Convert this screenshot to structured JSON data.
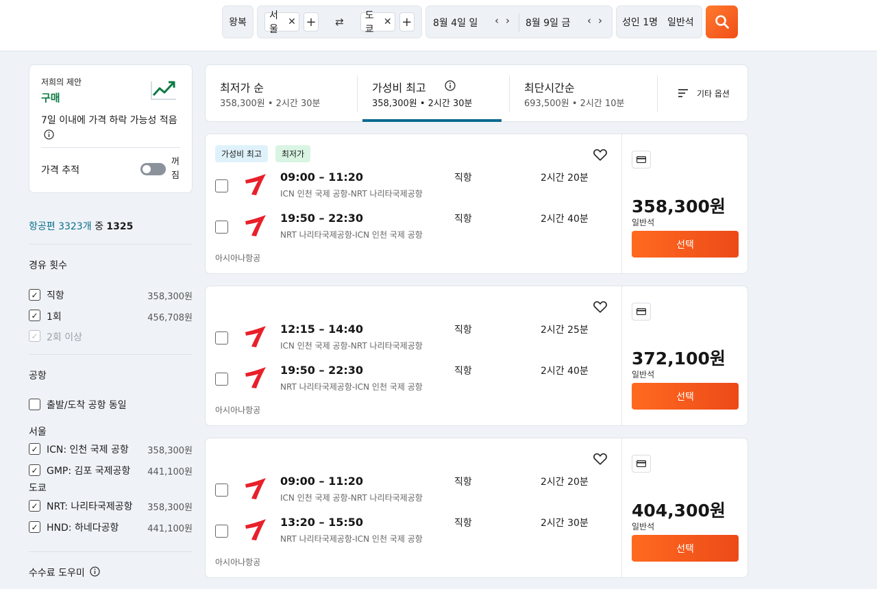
{
  "search": {
    "trip_type": "왕복",
    "origin": "서울",
    "destination": "도쿄",
    "depart_date": "8월 4일 일",
    "return_date": "8월 9일 금",
    "travelers": "성인 1명",
    "cabin": "일반석",
    "remove_glyph": "✕",
    "add_glyph": "+",
    "swap_glyph": "⇄",
    "prev_glyph": "‹",
    "next_glyph": "›"
  },
  "advice": {
    "label": "저희의 제안",
    "verdict": "구매",
    "detail": "7일 이내에 가격 하락 가능성 적음",
    "price_tracking_label": "가격 추적",
    "toggle_state": "꺼짐",
    "toggle_state_line1": "꺼",
    "toggle_state_line2": "짐"
  },
  "results_count": {
    "link_text": "항공편 3323개",
    "middle": "중",
    "shown": "1325"
  },
  "filters": {
    "stops": {
      "title": "경유 횟수",
      "options": [
        {
          "label": "직항",
          "price": "358,300원",
          "checked": true
        },
        {
          "label": "1회",
          "price": "456,708원",
          "checked": true
        },
        {
          "label": "2회 이상",
          "price": "",
          "checked": true,
          "disabled": true
        }
      ]
    },
    "airports": {
      "title": "공항",
      "same_airport_label": "출발/도착 공항 동일",
      "groups": [
        {
          "city": "서울",
          "items": [
            {
              "label": "ICN: 인천 국제 공항",
              "price": "358,300원"
            },
            {
              "label": "GMP: 김포 국제공항",
              "price": "441,100원"
            }
          ]
        },
        {
          "city": "도쿄",
          "items": [
            {
              "label": "NRT: 나리타국제공항",
              "price": "358,300원"
            },
            {
              "label": "HND: 하네다공항",
              "price": "441,100원"
            }
          ]
        }
      ]
    },
    "fee_helper": "수수료 도우미"
  },
  "sort": {
    "options": [
      {
        "title": "최저가 순",
        "summary": "358,300원 • 2시간 30분"
      },
      {
        "title": "가성비 최고",
        "summary": "358,300원 • 2시간 30분",
        "active": true
      },
      {
        "title": "최단시간순",
        "summary": "693,500원 • 2시간 10분"
      }
    ],
    "other_options": "기타 옵션"
  },
  "results": [
    {
      "tags": [
        "가성비 최고",
        "최저가"
      ],
      "legs": [
        {
          "times": "09:00 – 11:20",
          "route": "ICN 인천 국제 공항-NRT 나리타국제공항",
          "stops": "직항",
          "duration": "2시간 20분"
        },
        {
          "times": "19:50 – 22:30",
          "route": "NRT 나리타국제공항-ICN 인천 국제 공항",
          "stops": "직항",
          "duration": "2시간 40분"
        }
      ],
      "airline": "아시아나항공",
      "price": "358,300원",
      "cabin": "일반석",
      "select": "선택"
    },
    {
      "tags": [],
      "legs": [
        {
          "times": "12:15 – 14:40",
          "route": "ICN 인천 국제 공항-NRT 나리타국제공항",
          "stops": "직항",
          "duration": "2시간 25분"
        },
        {
          "times": "19:50 – 22:30",
          "route": "NRT 나리타국제공항-ICN 인천 국제 공항",
          "stops": "직항",
          "duration": "2시간 40분"
        }
      ],
      "airline": "아시아나항공",
      "price": "372,100원",
      "cabin": "일반석",
      "select": "선택"
    },
    {
      "tags": [],
      "legs": [
        {
          "times": "09:00 – 11:20",
          "route": "ICN 인천 국제 공항-NRT 나리타국제공항",
          "stops": "직항",
          "duration": "2시간 20분"
        },
        {
          "times": "13:20 – 15:50",
          "route": "NRT 나리타국제공항-ICN 인천 국제 공항",
          "stops": "직항",
          "duration": "2시간 30분"
        }
      ],
      "airline": "아시아나항공",
      "price": "404,300원",
      "cabin": "일반석",
      "select": "선택"
    }
  ],
  "colors": {
    "accent": "#f2581b",
    "link": "#0b6e8a",
    "active_tab": "#0a6b8e",
    "advice_green": "#0c7a43",
    "airline_red": "#e8202a"
  }
}
